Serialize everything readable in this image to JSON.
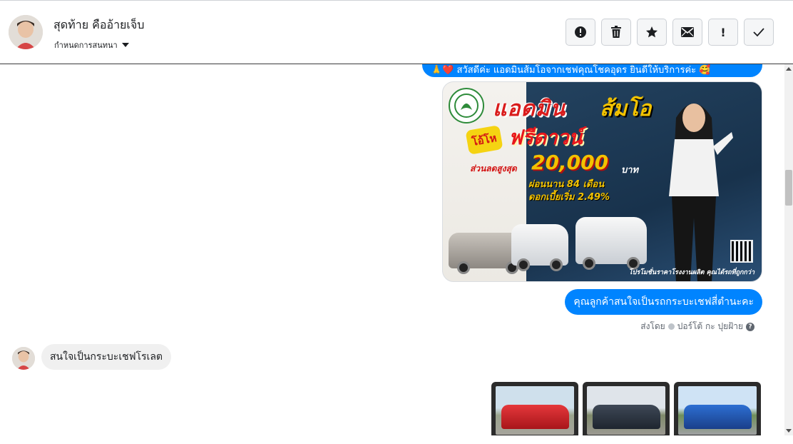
{
  "header": {
    "contact_name": "สุดท้าย คืออ้ายเจ็บ",
    "assign_label": "กำหนดการสนทนา",
    "actions": [
      {
        "name": "spam-icon",
        "label": "!"
      },
      {
        "name": "trash-icon",
        "label": ""
      },
      {
        "name": "star-icon",
        "label": ""
      },
      {
        "name": "mail-icon",
        "label": ""
      },
      {
        "name": "follow-up-icon",
        "label": "!"
      },
      {
        "name": "check-icon",
        "label": ""
      }
    ]
  },
  "messages": {
    "top_partial": "🙏❤️ สวัสดีค่ะ แอดมินส้มโอจากเชฟคุณโชคอุดร ยินดีให้บริการค่ะ 🥰",
    "ad_image": {
      "title_part1": "แอดมิน",
      "title_part2": "ส้มโอ",
      "free_down": "ฟรีดาวน์",
      "burst": "โอ้โห",
      "discount_label": "ส่วนลดสูงสุด",
      "amount": "20,000",
      "baht": "บาท",
      "line1": "ผ่อนนาน 84 เดือน",
      "line2": "ดอกเบี้ยเริ่ม 2.49%",
      "footer": "โปรโมชั่นราคาโรงงานผลิต คุณได้รถที่ถูกกว่า"
    },
    "outgoing_2": "คุณลูกค้าสนใจเป็นรถกระบะเชฟสี่ตำนะคะ",
    "sent_by_label": "ส่งโดย",
    "sent_by_name": "ปอร์โต้ กะ ปุยฝ้าย",
    "incoming_1": "สนใจเป็นกระบะเชฟโรเลต"
  },
  "colors": {
    "outgoing_bubble": "#0084ff",
    "incoming_bubble": "#f0f0f0"
  }
}
